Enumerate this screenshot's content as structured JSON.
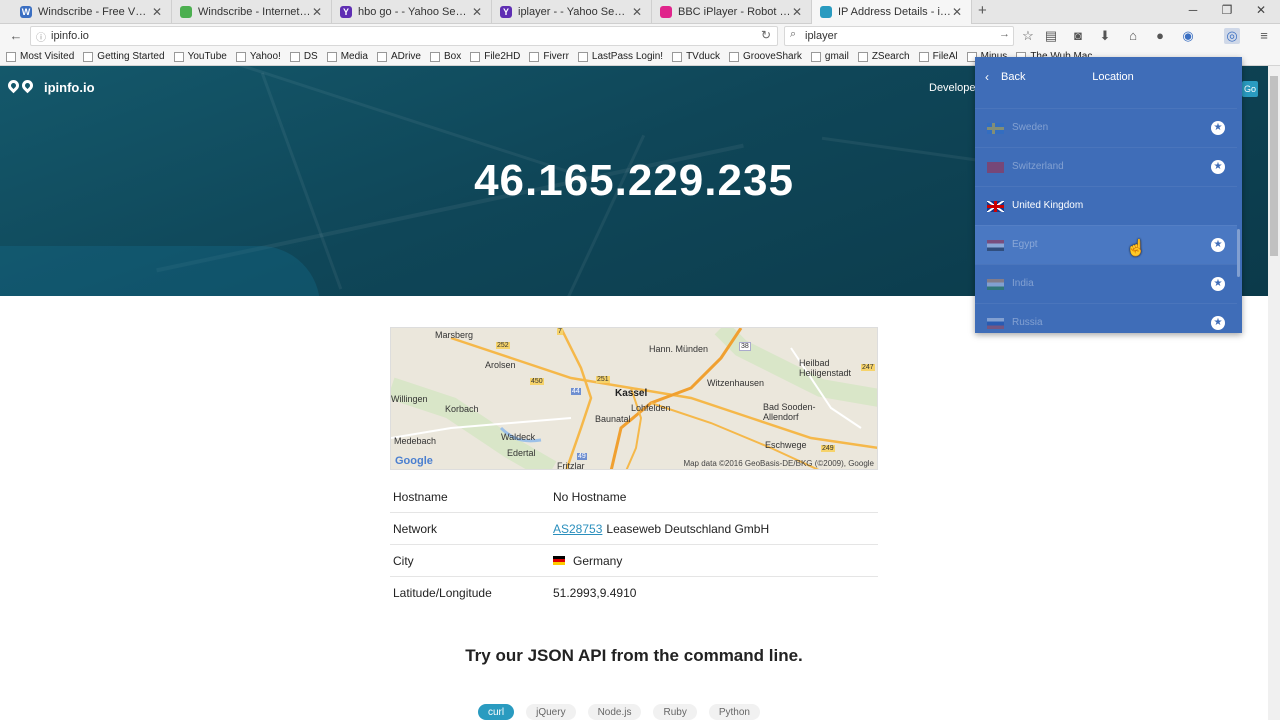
{
  "browser": {
    "tabs": [
      {
        "title": "Windscribe - Free VPN an...",
        "favicon": "windscribe-icon",
        "color": "#3b6fc2",
        "glyph": "W"
      },
      {
        "title": "Windscribe - Internet as it ...",
        "favicon": "leaf-icon",
        "color": "#4caf50",
        "glyph": ""
      },
      {
        "title": "hbo go - - Yahoo Search R...",
        "favicon": "yahoo-icon",
        "color": "#5f2eb3",
        "glyph": "Y"
      },
      {
        "title": "iplayer - - Yahoo Search R...",
        "favicon": "yahoo-icon",
        "color": "#5f2eb3",
        "glyph": "Y"
      },
      {
        "title": "BBC iPlayer - Robot Wars ...",
        "favicon": "bbc-icon",
        "color": "#e0258c",
        "glyph": ""
      },
      {
        "title": "IP Address Details - ipinfo.io",
        "favicon": "ipinfo-icon",
        "color": "#2a9bc0",
        "glyph": ""
      }
    ],
    "url": "ipinfo.io",
    "search": "iplayer",
    "bookmarks": [
      "Most Visited",
      "Getting Started",
      "YouTube",
      "Yahoo!",
      "DS",
      "Media",
      "ADrive",
      "Box",
      "File2HD",
      "Fiverr",
      "LastPass Login!",
      "TVduck",
      "GrooveShark",
      "gmail",
      "ZSearch",
      "FileAl",
      "Minus",
      "The Wub Mac"
    ]
  },
  "site": {
    "logo": "ipinfo.io",
    "nav_developers": "Developer",
    "ip": "46.165.229.235",
    "map": {
      "labels": [
        "Marsberg",
        "Arolsen",
        "Hann. Münden",
        "Heilbad Heiligenstadt",
        "Kassel",
        "Witzenhausen",
        "Korbach",
        "Lohfelden",
        "Baunatal",
        "Bad Sooden-Allendorf",
        "Medebach",
        "Waldeck",
        "Edertal",
        "Eschwege",
        "Fritzlar",
        "Willingen"
      ],
      "road_numbers": [
        "252",
        "7",
        "38",
        "247",
        "450",
        "44",
        "251",
        "49",
        "249"
      ],
      "google": "Google",
      "attribution": "Map data ©2016 GeoBasis-DE/BKG (©2009), Google"
    },
    "details": [
      {
        "label": "Hostname",
        "value": "No Hostname"
      },
      {
        "label": "Network",
        "link": "AS28753",
        "value": "Leaseweb Deutschland GmbH"
      },
      {
        "label": "City",
        "value": "Germany"
      },
      {
        "label": "Latitude/Longitude",
        "value": "51.2993,9.4910"
      }
    ],
    "api_heading": "Try our JSON API from the command line.",
    "languages": [
      "curl",
      "jQuery",
      "Node.js",
      "Ruby",
      "Python"
    ]
  },
  "vpn_panel": {
    "back": "Back",
    "title": "Location",
    "locations": [
      {
        "name": "Sweden",
        "selected": false
      },
      {
        "name": "Switzerland",
        "selected": false
      },
      {
        "name": "United Kingdom",
        "selected": true
      },
      {
        "name": "Egypt",
        "selected": false
      },
      {
        "name": "India",
        "selected": false
      },
      {
        "name": "Russia",
        "selected": false
      }
    ],
    "go": "Go"
  }
}
